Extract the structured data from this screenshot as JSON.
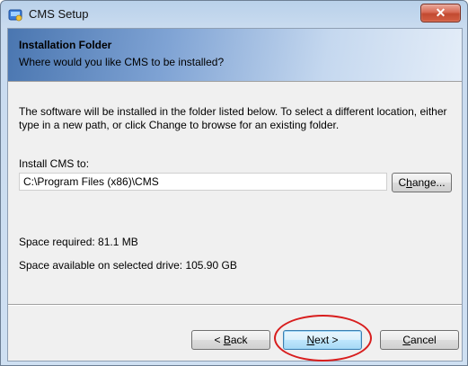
{
  "window": {
    "title": "CMS Setup",
    "close_symbol": "✕"
  },
  "header": {
    "title": "Installation Folder",
    "subtitle": "Where would you like CMS to be installed?"
  },
  "body": {
    "description": "The software will be installed in the folder listed below. To select a different location, either type in a new path, or click Change to browse for an existing folder.",
    "install_label": "Install CMS to:",
    "install_path": "C:\\Program Files (x86)\\CMS",
    "change_button": {
      "accel": "h",
      "before": "C",
      "after": "ange..."
    },
    "space_required": "Space required: 81.1 MB",
    "space_available": "Space available on selected drive: 105.90 GB"
  },
  "footer": {
    "back_button": {
      "prefix": "< ",
      "accel": "B",
      "rest": "ack"
    },
    "next_button": {
      "accel": "N",
      "rest": "ext >"
    },
    "cancel_button": {
      "accel": "C",
      "rest": "ancel"
    }
  },
  "annotation": {
    "color": "#d81e1e"
  }
}
